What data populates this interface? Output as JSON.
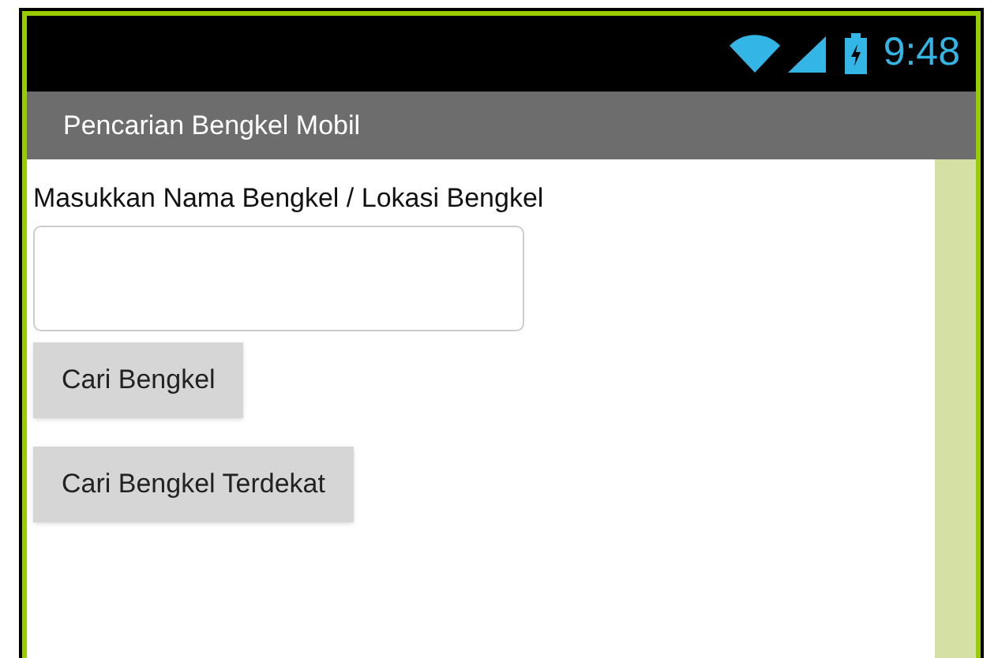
{
  "status_bar": {
    "time": "9:48"
  },
  "title_bar": {
    "title": "Pencarian Bengkel Mobil"
  },
  "form": {
    "label": "Masukkan Nama Bengkel / Lokasi Bengkel",
    "buttons": [
      {
        "label": "Cari Bengkel"
      },
      {
        "label": "Cari Bengkel Terdekat"
      }
    ]
  }
}
